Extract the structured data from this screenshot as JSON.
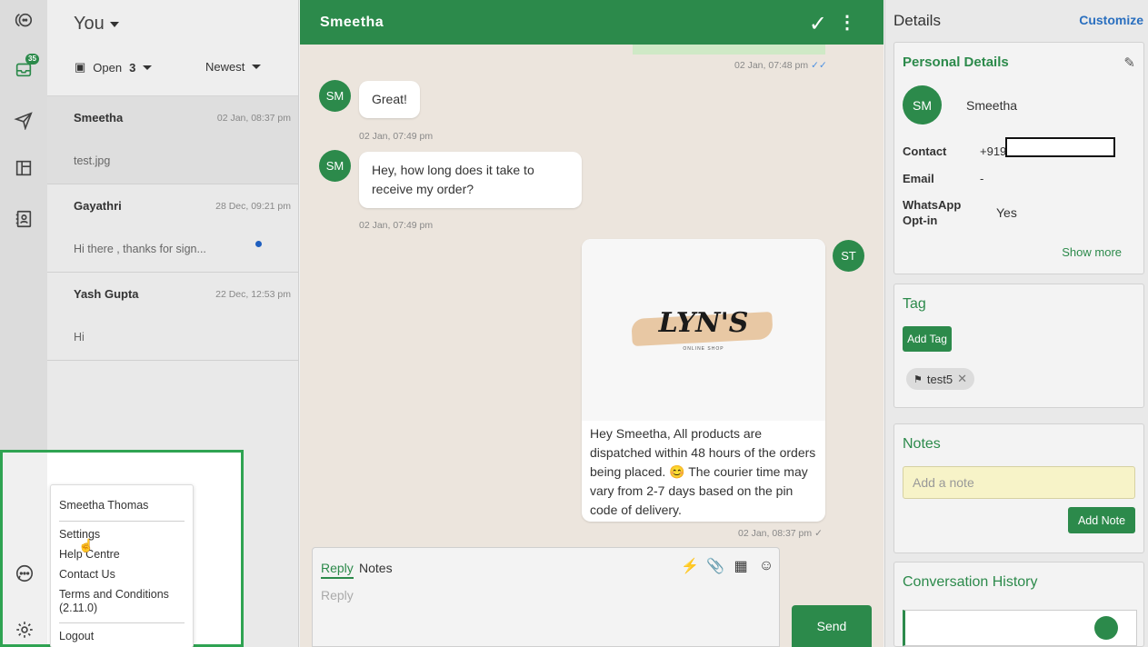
{
  "rail": {
    "inbox_badge": "35"
  },
  "list": {
    "owner": "You",
    "status": "Open",
    "status_count": "3",
    "sort": "Newest",
    "conversations": [
      {
        "name": "Smeetha",
        "time": "02 Jan, 08:37 pm",
        "preview": "test.jpg",
        "unread": false
      },
      {
        "name": "Gayathri",
        "time": "28 Dec, 09:21 pm",
        "preview": "Hi there , thanks for sign...",
        "unread": true
      },
      {
        "name": "Yash Gupta",
        "time": "22 Dec, 12:53 pm",
        "preview": "Hi",
        "unread": false
      }
    ]
  },
  "chat": {
    "title": "Smeetha",
    "messages": [
      {
        "sender": "SM",
        "text": "Great!",
        "time": "02 Jan, 07:49 pm"
      },
      {
        "sender": "SM",
        "text": "Hey, how long does it take to receive my order?",
        "time": "02 Jan, 07:49 pm"
      }
    ],
    "top_outgoing_time": "02 Jan, 07:48 pm",
    "media_message": {
      "sender": "ST",
      "logo_text": "LYN'S",
      "logo_subtext": "ONLINE SHOP",
      "caption": "Hey Smeetha,  All products are dispatched within 48 hours of the orders being placed. 😊 The courier time may vary from 2-7 days based on the pin code of delivery.",
      "time": "02 Jan, 08:37 pm"
    },
    "composer": {
      "tab_reply": "Reply",
      "tab_notes": "Notes",
      "placeholder": "Reply",
      "send_label": "Send"
    }
  },
  "details": {
    "title": "Details",
    "customize": "Customize",
    "personal": {
      "title": "Personal Details",
      "avatar": "SM",
      "name": "Smeetha",
      "contact_label": "Contact",
      "contact_value": "+919",
      "email_label": "Email",
      "email_value": "-",
      "whatsapp_label": "WhatsApp Opt-in",
      "whatsapp_value": "Yes",
      "show_more": "Show more"
    },
    "tag": {
      "title": "Tag",
      "add_label": "Add Tag",
      "tags": [
        "test5"
      ]
    },
    "notes": {
      "title": "Notes",
      "placeholder": "Add a note",
      "add_label": "Add Note"
    },
    "history": {
      "title": "Conversation History"
    }
  },
  "menu": {
    "user_name": "Smeetha Thomas",
    "settings": "Settings",
    "help": "Help Centre",
    "contact": "Contact Us",
    "terms": "Terms and Conditions",
    "version": "(2.11.0)",
    "logout": "Logout"
  }
}
